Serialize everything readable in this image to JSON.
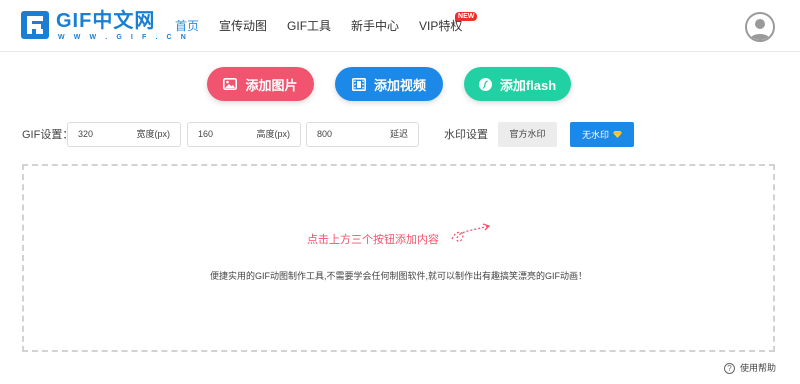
{
  "logo": {
    "title": "GIF中文网",
    "subtitle": "W W W . G I F . C N",
    "brand_color": "#1a7fd4"
  },
  "nav": {
    "items": [
      {
        "label": "首页",
        "active": true
      },
      {
        "label": "宣传动图",
        "active": false
      },
      {
        "label": "GIF工具",
        "active": false
      },
      {
        "label": "新手中心",
        "active": false
      },
      {
        "label": "VIP特权",
        "active": false,
        "badge": "NEW"
      }
    ],
    "active_color": "#2a8ee8"
  },
  "user": {
    "avatar_icon": "user-avatar-icon"
  },
  "actions": {
    "add_image": {
      "label": "添加图片",
      "icon": "image-icon",
      "color": "#f0546e"
    },
    "add_video": {
      "label": "添加视频",
      "icon": "film-icon",
      "color": "#1c88e8"
    },
    "add_flash": {
      "label": "添加flash",
      "icon": "flash-icon",
      "color": "#22d1a3"
    }
  },
  "settings": {
    "label": "GIF设置：",
    "width": {
      "value": "320",
      "unit": "宽度(px)"
    },
    "height": {
      "value": "160",
      "unit": "高度(px)"
    },
    "delay": {
      "value": "800",
      "unit": "延迟"
    },
    "watermark_label": "水印设置",
    "watermark_official": "官方水印",
    "watermark_none": "无水印",
    "watermark_none_icon": "diamond-icon"
  },
  "drop_area": {
    "hint": "点击上方三个按钮添加内容",
    "description": "便捷实用的GIF动图制作工具,不需要学会任何制图软件,就可以制作出有趣搞笑漂亮的GIF动画！"
  },
  "help": {
    "label": "使用帮助",
    "icon": "question-icon"
  }
}
